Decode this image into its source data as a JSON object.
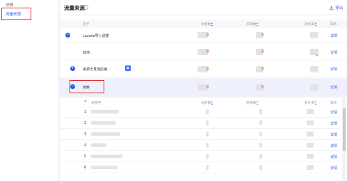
{
  "sidebar": {
    "items": [
      {
        "label": "详情"
      },
      {
        "label": "流量来源",
        "active": true
      }
    ]
  },
  "card": {
    "title": "流量来源",
    "help_icon": "?",
    "export_label": "导出",
    "columns": {
      "name": "名字",
      "visitors": "访客数",
      "buyers": "买家数",
      "conversion": "转化率",
      "action": "操作"
    },
    "rows": [
      {
        "toggle": "−",
        "name": "Lazada导入流量",
        "action": "详情"
      },
      {
        "toggle": "",
        "name": "其他",
        "action": "详情"
      },
      {
        "toggle": "+",
        "name": "来源于其他店铺",
        "action": "详情"
      },
      {
        "toggle": "−",
        "name": "搜索",
        "action": "详情"
      }
    ],
    "sub": {
      "columns": {
        "index": "#",
        "keyword": "关键字",
        "visitors": "访客数",
        "buyers": "买家数",
        "conversion": "转化率",
        "action": "操作"
      },
      "rows": [
        {
          "index": "1",
          "action": "详情"
        },
        {
          "index": "2",
          "action": "详情"
        },
        {
          "index": "3",
          "action": "详情"
        },
        {
          "index": "4",
          "action": "详情"
        },
        {
          "index": "5",
          "action": "详情"
        },
        {
          "index": "6",
          "action": "详情"
        }
      ]
    }
  },
  "colors": {
    "accent": "#2b5ce6",
    "highlight": "#d9252b"
  }
}
